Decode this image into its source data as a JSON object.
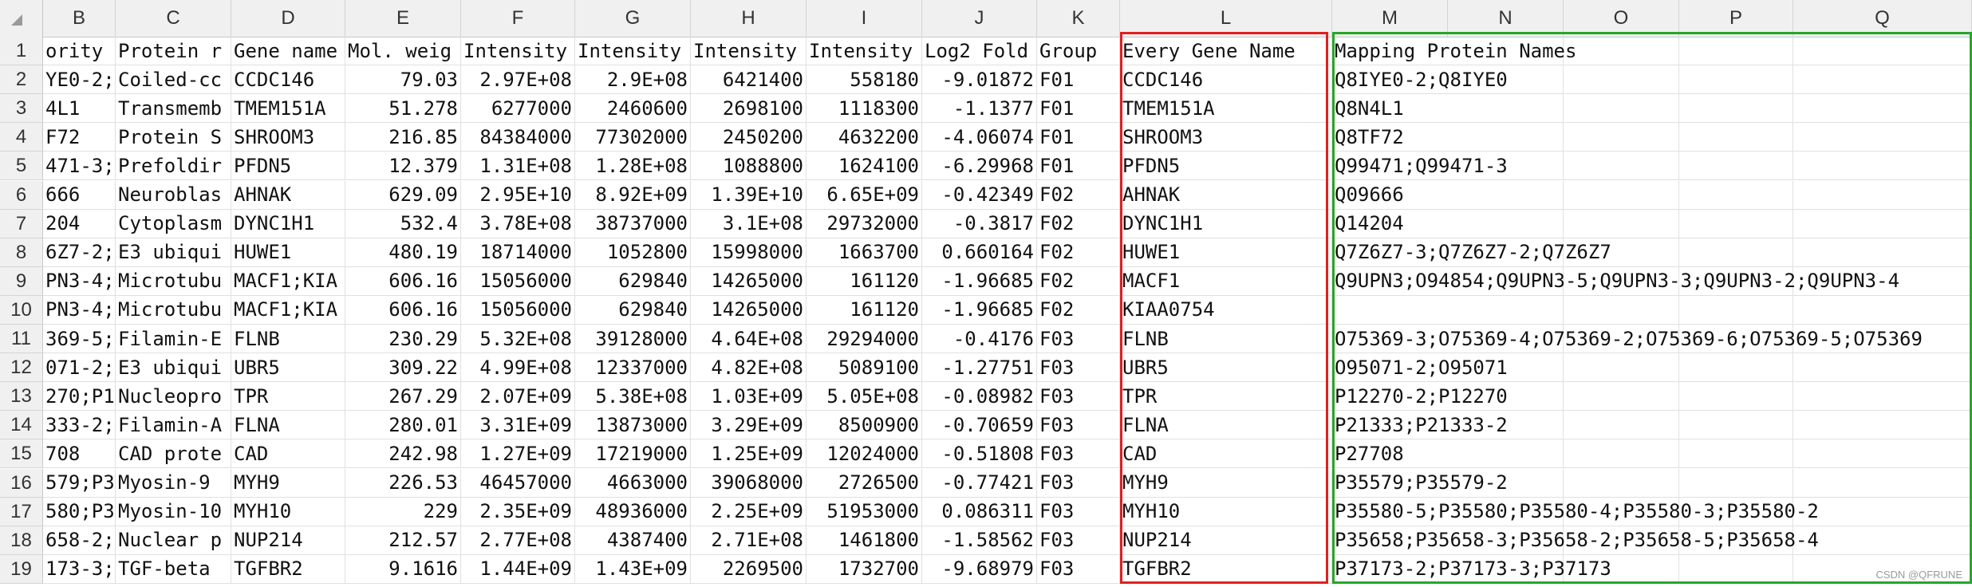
{
  "columns": [
    "B",
    "C",
    "D",
    "E",
    "F",
    "G",
    "H",
    "I",
    "J",
    "K",
    "L",
    "M",
    "N",
    "O",
    "P",
    "Q"
  ],
  "rows": [
    {
      "num": "1",
      "cells": [
        "ority",
        "Protein r",
        "Gene name",
        "Mol. weig",
        "Intensity",
        "Intensity",
        "Intensity",
        "Intensity",
        "Log2 Fold",
        "Group",
        "Every Gene Name",
        "Mapping Protein Names"
      ]
    },
    {
      "num": "2",
      "cells": [
        "YE0-2;",
        "Coiled-cc",
        "CCDC146",
        "79.03",
        "2.97E+08",
        "2.9E+08",
        "6421400",
        "558180",
        "-9.01872",
        "F01",
        "CCDC146",
        "Q8IYE0-2;Q8IYE0"
      ]
    },
    {
      "num": "3",
      "cells": [
        "4L1",
        "Transmemb",
        "TMEM151A",
        "51.278",
        "6277000",
        "2460600",
        "2698100",
        "1118300",
        "-1.1377",
        "F01",
        "TMEM151A",
        "Q8N4L1"
      ]
    },
    {
      "num": "4",
      "cells": [
        "F72",
        "Protein S",
        "SHROOM3",
        "216.85",
        "84384000",
        "77302000",
        "2450200",
        "4632200",
        "-4.06074",
        "F01",
        "SHROOM3",
        "Q8TF72"
      ]
    },
    {
      "num": "5",
      "cells": [
        "471-3;",
        "Prefoldir",
        "PFDN5",
        "12.379",
        "1.31E+08",
        "1.28E+08",
        "1088800",
        "1624100",
        "-6.29968",
        "F01",
        "PFDN5",
        "Q99471;Q99471-3"
      ]
    },
    {
      "num": "6",
      "cells": [
        "666",
        "Neuroblas",
        "AHNAK",
        "629.09",
        "2.95E+10",
        "8.92E+09",
        "1.39E+10",
        "6.65E+09",
        "-0.42349",
        "F02",
        "AHNAK",
        "Q09666"
      ]
    },
    {
      "num": "7",
      "cells": [
        "204",
        "Cytoplasm",
        "DYNC1H1",
        "532.4",
        "3.78E+08",
        "38737000",
        "3.1E+08",
        "29732000",
        "-0.3817",
        "F02",
        "DYNC1H1",
        "Q14204"
      ]
    },
    {
      "num": "8",
      "cells": [
        "6Z7-2;",
        "E3 ubiqui",
        "HUWE1",
        "480.19",
        "18714000",
        "1052800",
        "15998000",
        "1663700",
        "0.660164",
        "F02",
        "HUWE1",
        "Q7Z6Z7-3;Q7Z6Z7-2;Q7Z6Z7"
      ]
    },
    {
      "num": "9",
      "cells": [
        "PN3-4;",
        "Microtubu",
        "MACF1;KIA",
        "606.16",
        "15056000",
        "629840",
        "14265000",
        "161120",
        "-1.96685",
        "F02",
        "MACF1",
        "Q9UPN3;O94854;Q9UPN3-5;Q9UPN3-3;Q9UPN3-2;Q9UPN3-4"
      ]
    },
    {
      "num": "10",
      "cells": [
        "PN3-4;",
        "Microtubu",
        "MACF1;KIA",
        "606.16",
        "15056000",
        "629840",
        "14265000",
        "161120",
        "-1.96685",
        "F02",
        "KIAA0754",
        ""
      ]
    },
    {
      "num": "11",
      "cells": [
        "369-5;",
        "Filamin-E",
        "FLNB",
        "230.29",
        "5.32E+08",
        "39128000",
        "4.64E+08",
        "29294000",
        "-0.4176",
        "F03",
        "FLNB",
        "O75369-3;O75369-4;O75369-2;O75369-6;O75369-5;O75369"
      ]
    },
    {
      "num": "12",
      "cells": [
        "071-2;",
        "E3 ubiqui",
        "UBR5",
        "309.22",
        "4.99E+08",
        "12337000",
        "4.82E+08",
        "5089100",
        "-1.27751",
        "F03",
        "UBR5",
        "O95071-2;O95071"
      ]
    },
    {
      "num": "13",
      "cells": [
        "270;P1",
        "Nucleopro",
        "TPR",
        "267.29",
        "2.07E+09",
        "5.38E+08",
        "1.03E+09",
        "5.05E+08",
        "-0.08982",
        "F03",
        "TPR",
        "P12270-2;P12270"
      ]
    },
    {
      "num": "14",
      "cells": [
        "333-2;",
        "Filamin-A",
        "FLNA",
        "280.01",
        "3.31E+09",
        "13873000",
        "3.29E+09",
        "8500900",
        "-0.70659",
        "F03",
        "FLNA",
        "P21333;P21333-2"
      ]
    },
    {
      "num": "15",
      "cells": [
        "708",
        "CAD prote",
        "CAD",
        "242.98",
        "1.27E+09",
        "17219000",
        "1.25E+09",
        "12024000",
        "-0.51808",
        "F03",
        "CAD",
        "P27708"
      ]
    },
    {
      "num": "16",
      "cells": [
        "579;P3",
        "Myosin-9",
        "MYH9",
        "226.53",
        "46457000",
        "4663000",
        "39068000",
        "2726500",
        "-0.77421",
        "F03",
        "MYH9",
        "P35579;P35579-2"
      ]
    },
    {
      "num": "17",
      "cells": [
        "580;P3",
        "Myosin-10",
        "MYH10",
        "229",
        "2.35E+09",
        "48936000",
        "2.25E+09",
        "51953000",
        "0.086311",
        "F03",
        "MYH10",
        "P35580-5;P35580;P35580-4;P35580-3;P35580-2"
      ]
    },
    {
      "num": "18",
      "cells": [
        "658-2;",
        "Nuclear p",
        "NUP214",
        "212.57",
        "2.77E+08",
        "4387400",
        "2.71E+08",
        "1461800",
        "-1.58562",
        "F03",
        "NUP214",
        "P35658;P35658-3;P35658-2;P35658-5;P35658-4"
      ]
    },
    {
      "num": "19",
      "cells": [
        "173-3;",
        "TGF-beta",
        "TGFBR2",
        "9.1616",
        "1.44E+09",
        "1.43E+09",
        "2269500",
        "1732700",
        "-9.68979",
        "F03",
        "TGFBR2",
        "P37173-2;P37173-3;P37173"
      ]
    }
  ],
  "watermark": "CSDN @QFRUNE",
  "colors": {
    "red_highlight": "#e02020",
    "green_highlight": "#27a62a",
    "header_bg": "#f0f0f0"
  }
}
